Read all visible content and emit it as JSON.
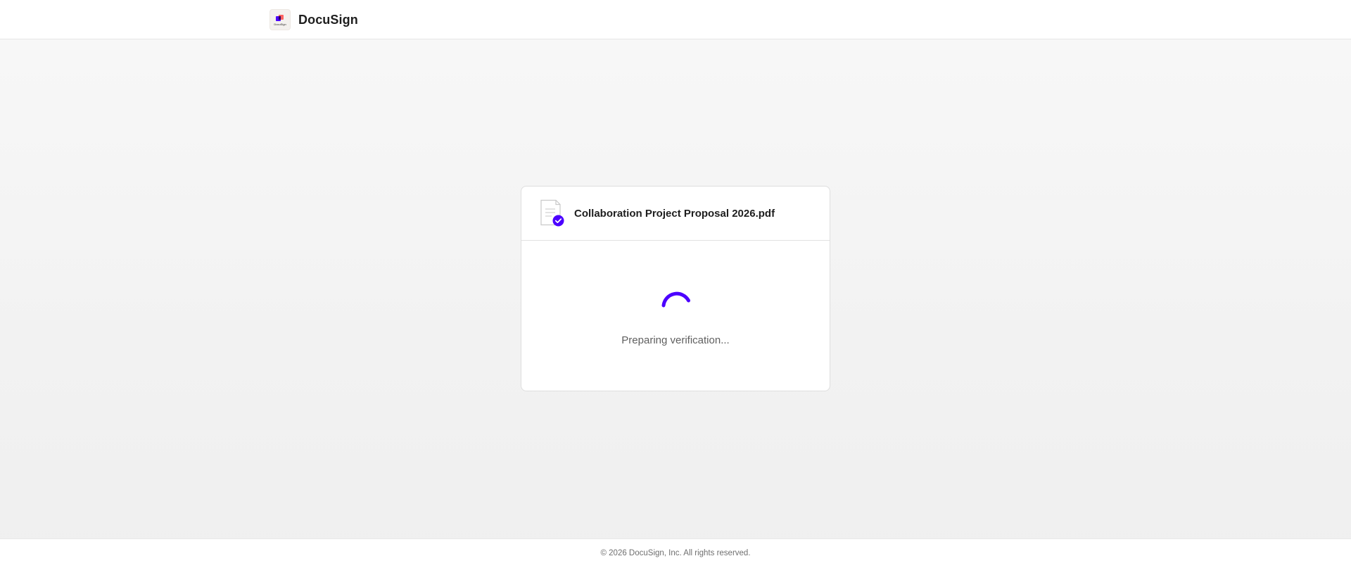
{
  "header": {
    "brand_name": "DocuSign",
    "logo_text": "DocuSign",
    "logo_icon": "docusign-logo-icon"
  },
  "card": {
    "file_icon": "document-check-icon",
    "file_name": "Collaboration Project Proposal 2026.pdf",
    "spinner_icon": "loading-spinner-icon",
    "status": "Preparing verification..."
  },
  "footer": {
    "copyright": "© 2026 DocuSign, Inc. All rights reserved."
  },
  "colors": {
    "accent": "#4c00ff",
    "page_background": "#f2f2f2",
    "card_background": "#ffffff"
  }
}
